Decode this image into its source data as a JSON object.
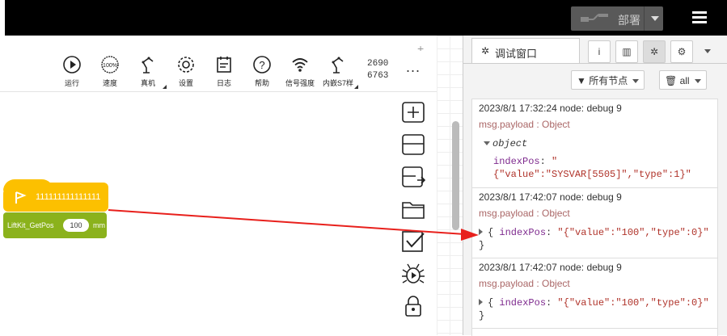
{
  "header": {
    "deploy_label": "部署"
  },
  "toolbar": {
    "items": [
      {
        "label": "运行",
        "icon": "play-icon"
      },
      {
        "label": "速度",
        "icon": "speed-icon"
      },
      {
        "label": "真机",
        "icon": "robot-arm-icon"
      },
      {
        "label": "设置",
        "icon": "gear-icon"
      },
      {
        "label": "日志",
        "icon": "log-icon"
      },
      {
        "label": "帮助",
        "icon": "help-icon"
      },
      {
        "label": "信号强度",
        "icon": "wifi-icon"
      },
      {
        "label": "内嵌S7样",
        "icon": "robot-arm-icon"
      }
    ],
    "speed_badge": "100%",
    "number_line1": "2690",
    "number_line2": "6763",
    "more": "..."
  },
  "blocks": {
    "hat_text": "111111111111111",
    "cmd_name": "LiftKit_GetPos",
    "cmd_value": "100",
    "cmd_unit": "mm"
  },
  "panel": {
    "tab_label": "调试窗口",
    "filter_nodes": "所有节点",
    "filter_all": "all",
    "messages": [
      {
        "meta": "2023/8/1 17:32:24   node: debug 9",
        "topic": "msg.payload : Object",
        "type_label": "object",
        "key": "indexPos",
        "value_line1": "\"",
        "value_line2": "{\"value\":\"SYSVAR[5505]\",\"type\":1}\""
      },
      {
        "meta": "2023/8/1 17:42:07   node: debug 9",
        "topic": "msg.payload : Object",
        "open": "{",
        "key": "indexPos",
        "value": "\"{\"value\":\"100\",\"type\":0}\"",
        "close": "}"
      },
      {
        "meta": "2023/8/1 17:42:07   node: debug 9",
        "topic": "msg.payload : Object",
        "open": "{",
        "key": "indexPos",
        "value": "\"{\"value\":\"100\",\"type\":0}\"",
        "close": "}"
      }
    ]
  },
  "colors": {
    "hat": "#fcc000",
    "command": "#8bb21c",
    "arrow": "#e8201c",
    "topbar": "#000000"
  }
}
